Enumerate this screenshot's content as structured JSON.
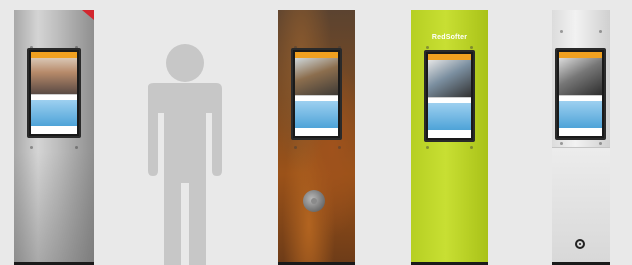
{
  "kiosks": [
    {
      "name": "stainless-steel",
      "finish_color": "#bdbdbd",
      "screen_content": "portrait-news"
    },
    {
      "name": "rust-finish",
      "finish_color": "#8a4a1c",
      "screen_content": "landscape-car"
    },
    {
      "name": "lime-green",
      "finish_color": "#c3da2c",
      "brand_label": "RedSofter",
      "screen_content": "car-advert"
    },
    {
      "name": "white",
      "finish_color": "#ececec",
      "screen_content": "car-advert"
    }
  ],
  "scale_figure": {
    "icon": "person-silhouette-icon",
    "color": "#c7c7c7"
  },
  "colors": {
    "background": "#e9e9e9",
    "screen_bezel": "#1a1a1a",
    "screen_topbar": "#f0a020",
    "screen_sky": "#4ea3d8",
    "corner_flag": "#d2262f"
  }
}
